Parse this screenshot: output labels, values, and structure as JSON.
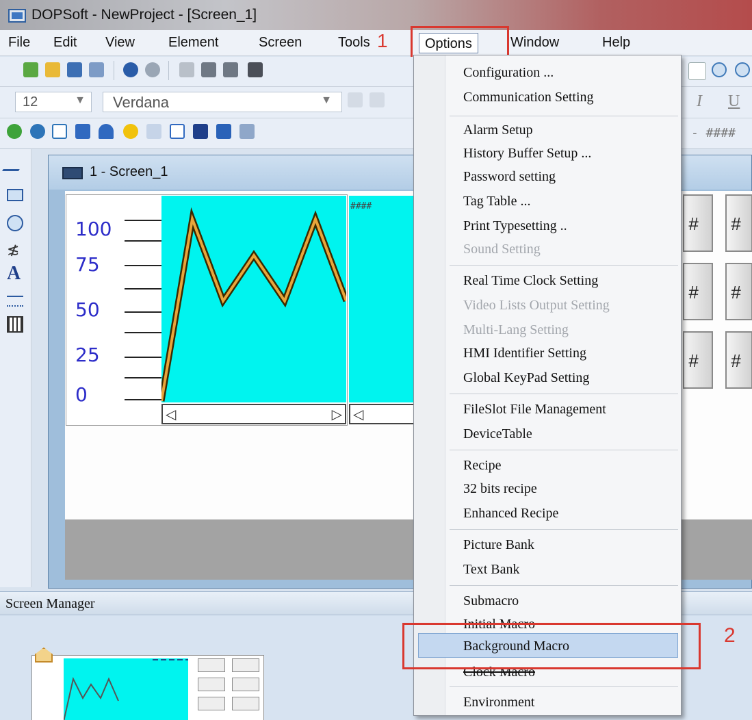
{
  "window": {
    "title": "DOPSoft - NewProject - [Screen_1]"
  },
  "menubar": {
    "items": [
      "File",
      "Edit",
      "View",
      "Element",
      "Screen",
      "Tools",
      "Options",
      "Window",
      "Help"
    ]
  },
  "callouts": {
    "one": "1",
    "two": "2"
  },
  "format_toolbar": {
    "font_size": "12",
    "font_name": "Verdana"
  },
  "document": {
    "title": "1 - Screen_1"
  },
  "chart_data": {
    "type": "line",
    "yticks": [
      "100",
      "75",
      "50",
      "25",
      "0"
    ],
    "ylim": [
      0,
      100
    ],
    "series": [
      {
        "values": [
          0,
          100,
          55,
          80,
          55,
          100,
          55
        ]
      }
    ]
  },
  "trend2": {
    "text": "####"
  },
  "hash_buttons": [
    "#",
    "#",
    "#",
    "#",
    "#",
    "#"
  ],
  "screen_manager": {
    "title": "Screen Manager"
  },
  "options_menu": {
    "items": [
      "Configuration ...",
      "Communication Setting",
      "Alarm Setup",
      "History Buffer Setup ...",
      "Password setting",
      "Tag Table ...",
      "Print Typesetting ..",
      "Sound Setting",
      "Real Time Clock Setting",
      "Video Lists Output Setting",
      "Multi-Lang Setting",
      "HMI Identifier Setting",
      "Global KeyPad Setting",
      "FileSlot File Management",
      "DeviceTable",
      "Recipe",
      "32 bits recipe",
      "Enhanced Recipe",
      "Picture Bank",
      "Text Bank",
      "Submacro",
      "Initial Macro",
      "Background Macro",
      "Clock Macro",
      "Environment"
    ]
  }
}
